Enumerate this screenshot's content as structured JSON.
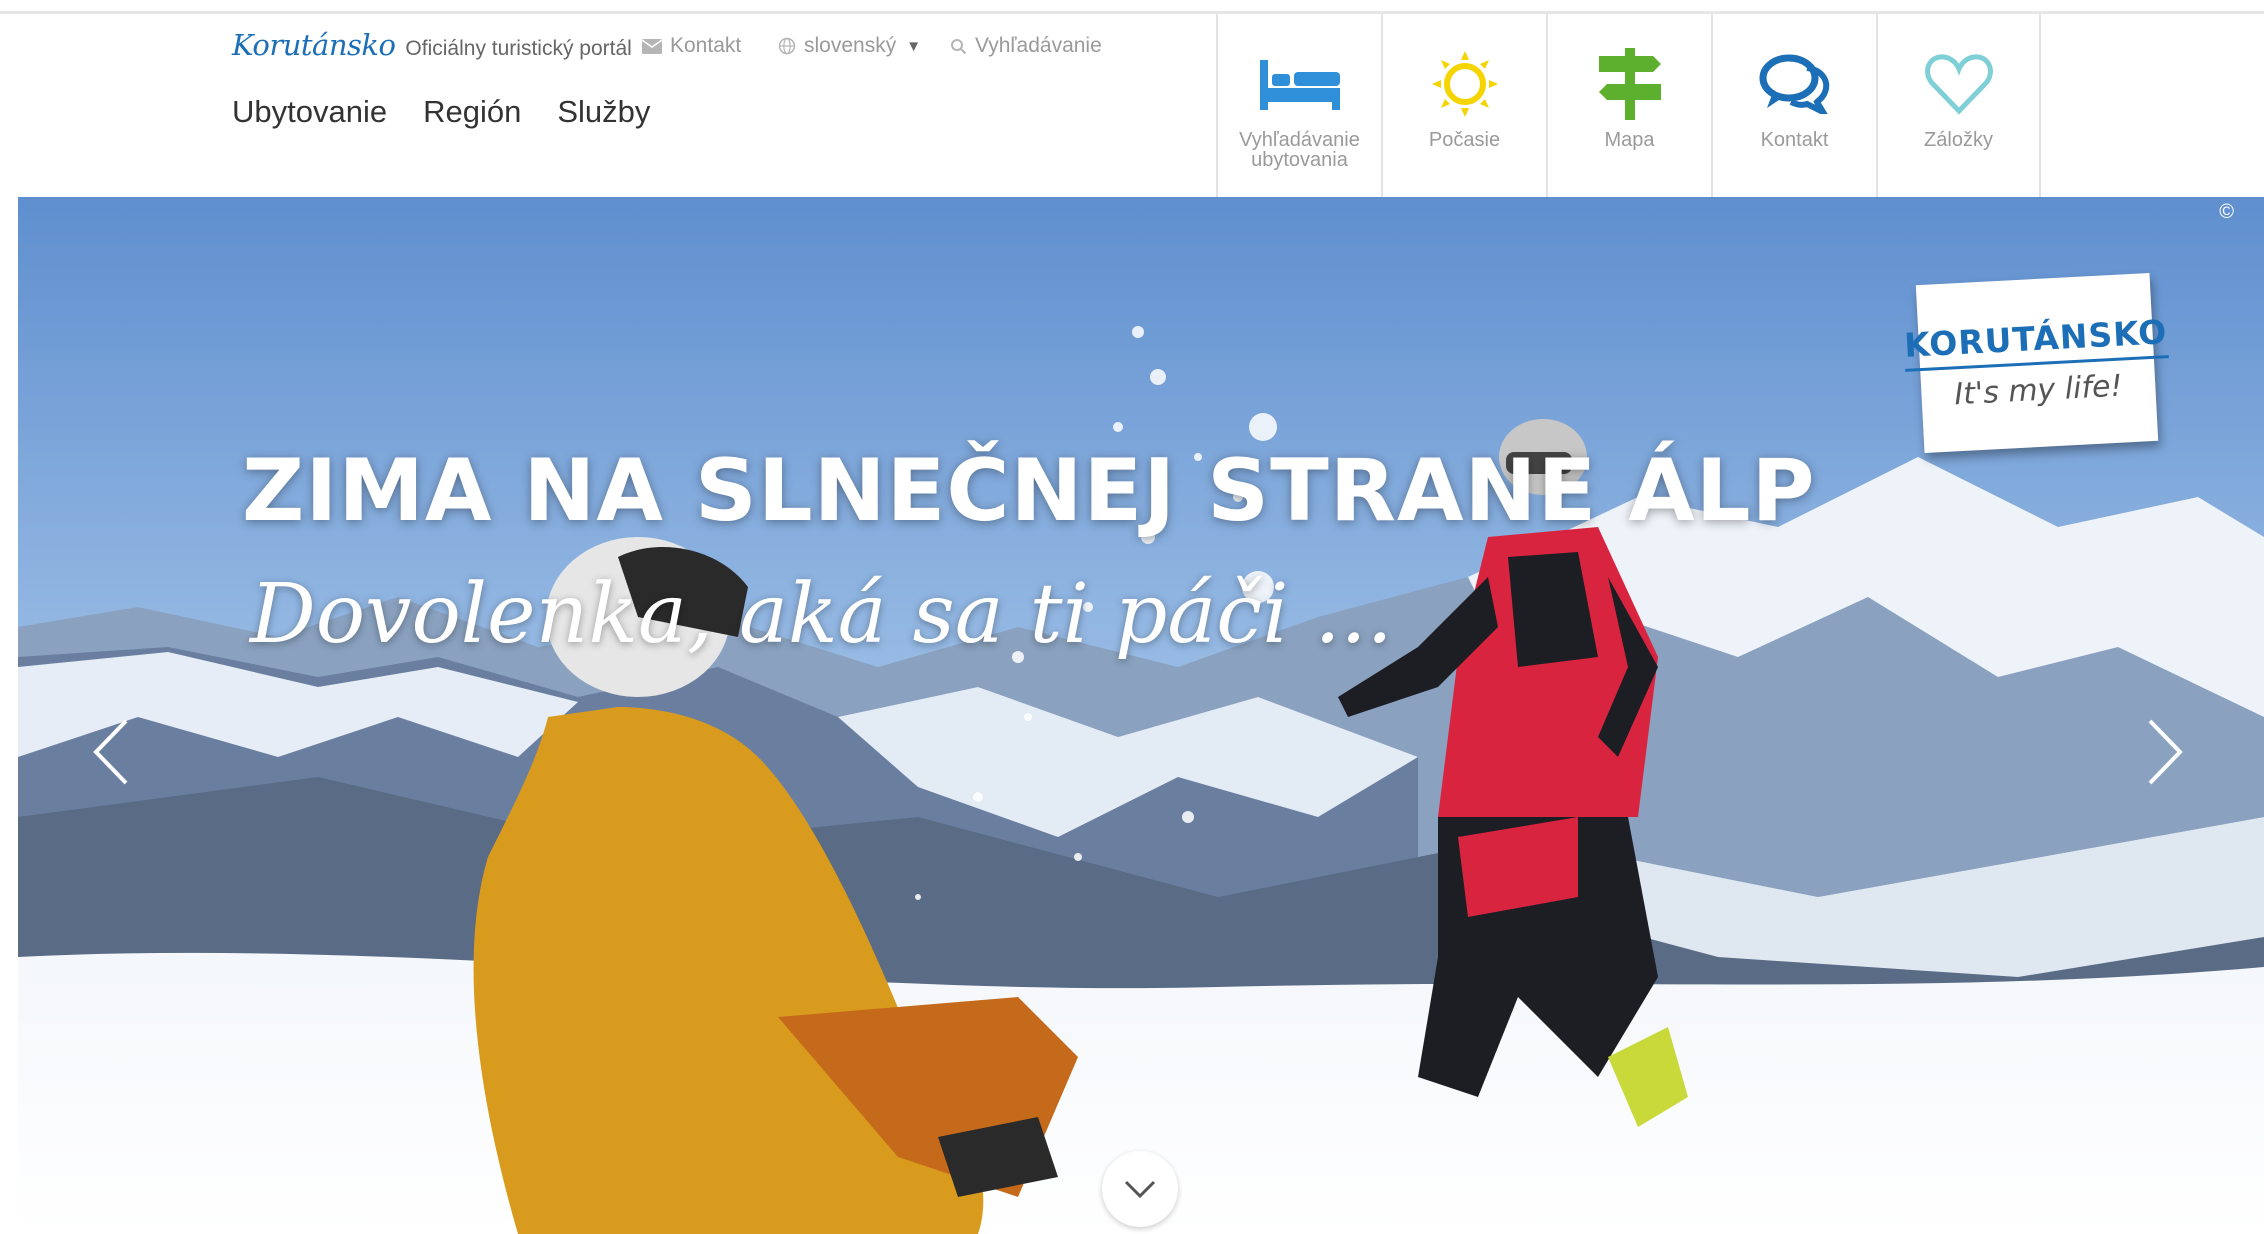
{
  "brand": {
    "logo": "Korutánsko",
    "tagline": "Oficiálny turistický portál"
  },
  "meta": {
    "contact": "Kontakt",
    "language": "slovenský",
    "search": "Vyhľadávanie"
  },
  "nav": [
    "Ubytovanie",
    "Región",
    "Služby"
  ],
  "tools": [
    {
      "label": "Vyhľadávanie ubytovania",
      "icon": "bed-icon",
      "color": "#2f8fd8"
    },
    {
      "label": "Počasie",
      "icon": "sun-icon",
      "color": "#f5d400"
    },
    {
      "label": "Mapa",
      "icon": "signpost-icon",
      "color": "#5db02d"
    },
    {
      "label": "Kontakt",
      "icon": "chat-icon",
      "color": "#1c6fb6"
    },
    {
      "label": "Záložky",
      "icon": "heart-icon",
      "color": "#7fd0d6"
    }
  ],
  "hero": {
    "title": "ZIMA NA SLNEČNEJ STRANE ÁLP",
    "subtitle": "Dovolenka, aká sa ti páči ...",
    "copyright": "©"
  },
  "badge": {
    "title": "KORUTÁNSKO",
    "subtitle": "It's my life!"
  },
  "colors": {
    "brand_blue": "#1c6fb6",
    "muted_text": "#9a9a9a"
  }
}
